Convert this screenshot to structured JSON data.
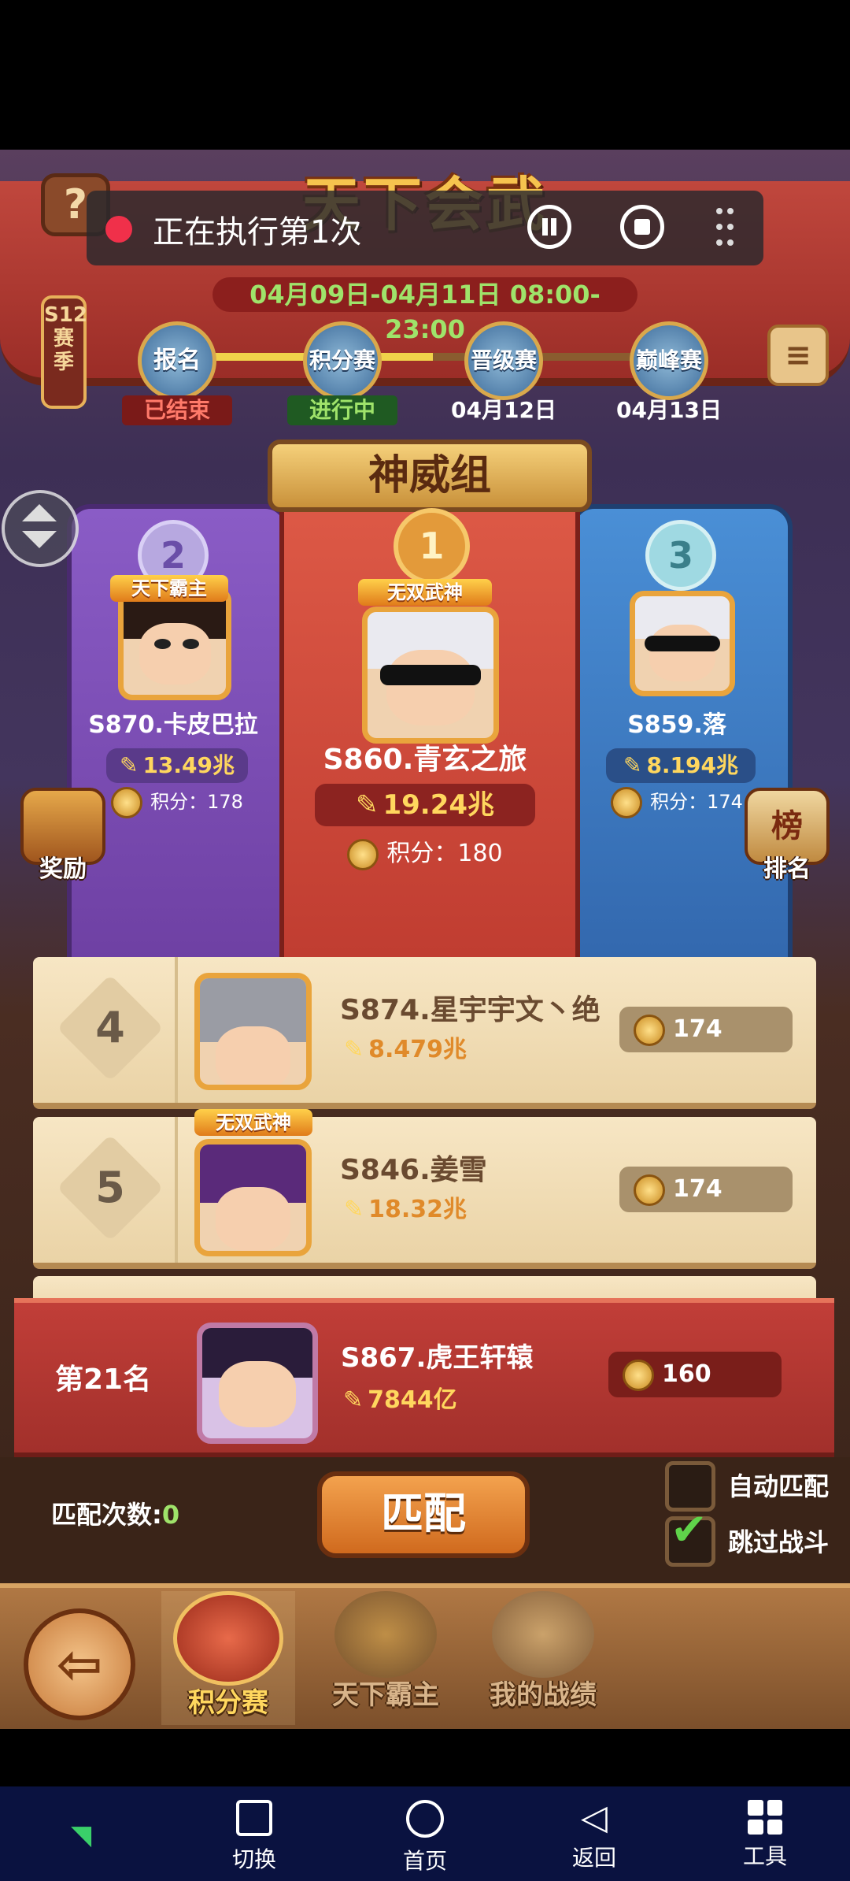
{
  "game_title": "天下会武",
  "help_label": "?",
  "recording": {
    "status": "正在执行第1次"
  },
  "date_range": "04月09日-04月11日 08:00-23:00",
  "season_label": "S12赛季",
  "stages": [
    {
      "name": "报名",
      "status": "已结束"
    },
    {
      "name": "积分赛",
      "status": "进行中"
    },
    {
      "name": "晋级赛",
      "status": "04月12日"
    },
    {
      "name": "巅峰赛",
      "status": "04月13日"
    }
  ],
  "group_name": "神威组",
  "podium": {
    "first": {
      "rank": "1",
      "title": "无双武神",
      "name": "S860.青玄之旅",
      "power": "19.24兆",
      "points_label": "积分：",
      "points": "180"
    },
    "second": {
      "rank": "2",
      "title": "天下霸主",
      "name": "S870.卡皮巴拉",
      "power": "13.49兆",
      "points_label": "积分：",
      "points": "178"
    },
    "third": {
      "rank": "3",
      "name": "S859.落",
      "power": "8.194兆",
      "points_label": "积分：",
      "points": "174"
    }
  },
  "side_buttons": {
    "reward": "奖励",
    "ranking": "排名",
    "ranking_icon_text": "榜"
  },
  "list": [
    {
      "rank": "4",
      "name": "S874.星宇宇文丶绝",
      "power": "8.479兆",
      "score": "174"
    },
    {
      "rank": "5",
      "title": "无双武神",
      "name": "S846.姜雪",
      "power": "18.32兆",
      "score": "174"
    }
  ],
  "my_rank": {
    "rank_label": "第21名",
    "name": "S867.虎王轩辕",
    "power": "7844亿",
    "score": "160"
  },
  "match": {
    "count_label": "匹配次数:",
    "count": "0",
    "button": "匹配",
    "auto_match": "自动匹配",
    "skip_battle": "跳过战斗"
  },
  "tabs": [
    "积分赛",
    "天下霸主",
    "我的战绩"
  ],
  "system_nav": [
    "切换",
    "首页",
    "返回",
    "工具"
  ],
  "colors": {
    "stage_done": "#f0d24a",
    "green_text": "#9fe36a",
    "accent_orange": "#e08a2a"
  }
}
